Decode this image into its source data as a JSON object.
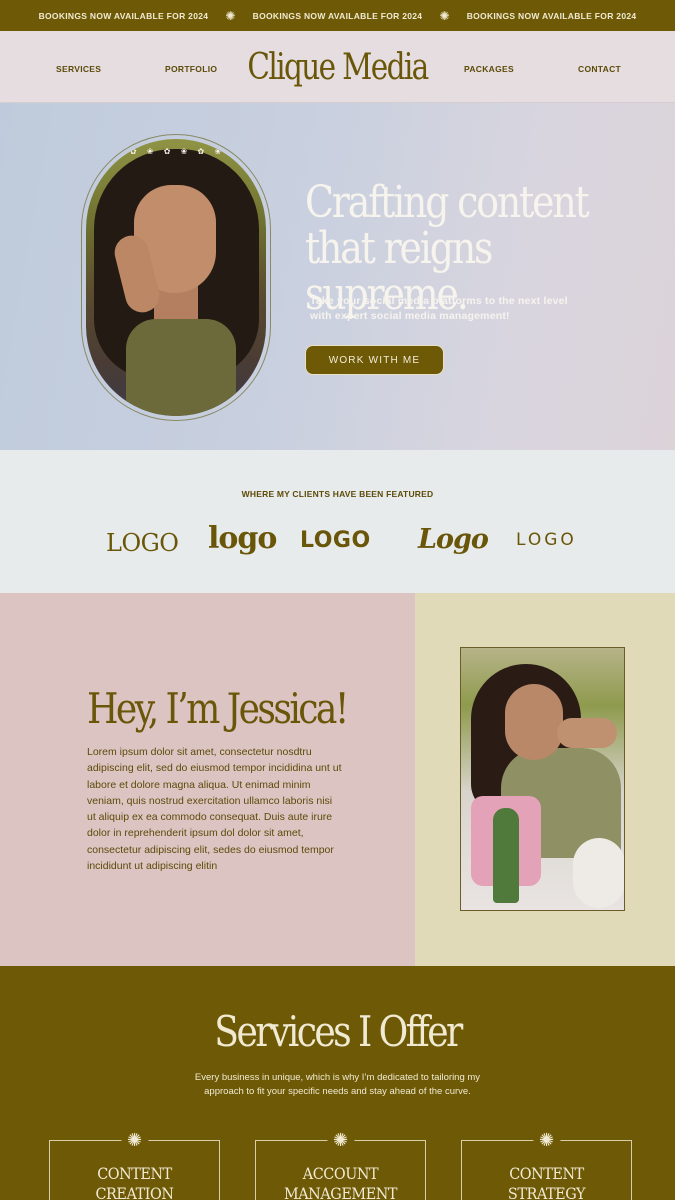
{
  "announcement": {
    "messages": [
      "BOOKINGS NOW AVAILABLE FOR 2024",
      "BOOKINGS NOW AVAILABLE FOR 2024",
      "BOOKINGS NOW AVAILABLE FOR 2024"
    ],
    "separator_icon": "flower-icon"
  },
  "nav": {
    "brand": "Clique Media",
    "items": [
      "SERVICES",
      "PORTFOLIO",
      "PACKAGES",
      "CONTACT"
    ]
  },
  "hero": {
    "title_line1": "Crafting content",
    "title_line2": "that reigns supreme.",
    "subtitle": "Take your social media platforms to the next level with expert social media management!",
    "cta_label": "WORK WITH ME"
  },
  "featured": {
    "heading": "WHERE MY CLIENTS HAVE BEEN FEATURED",
    "logos": [
      "LOGO",
      "logo",
      "LOGO",
      "Logo",
      "LOGO"
    ]
  },
  "about": {
    "heading": "Hey, I’m Jessica!",
    "body": "Lorem ipsum dolor sit amet, consectetur nosdtru adipiscing elit, sed do eiusmod tempor incididina unt ut labore et dolore magna aliqua. Ut enimad minim veniam, quis nostrud exercitation ullamco laboris nisi ut aliquip ex ea commodo consequat. Duis aute irure dolor in reprehenderit ipsum dol dolor sit amet, consectetur adipiscing elit, sedes do eiusmod tempor incididunt ut adipiscing elitin"
  },
  "services": {
    "heading": "Services I Offer",
    "intro_line1": "Every business in unique, which is why I’m dedicated to tailoring my",
    "intro_line2": "approach to fit your specific needs and stay ahead of the curve.",
    "cards": [
      {
        "title": "CONTENT\nCREATION"
      },
      {
        "title": "ACCOUNT\nMANAGEMENT"
      },
      {
        "title": "CONTENT\nSTRATEGY"
      }
    ]
  },
  "colors": {
    "brand_olive": "#6e5a06",
    "cream": "#f1ead2",
    "blush": "#dcc4c3",
    "sand": "#e1dab9"
  }
}
